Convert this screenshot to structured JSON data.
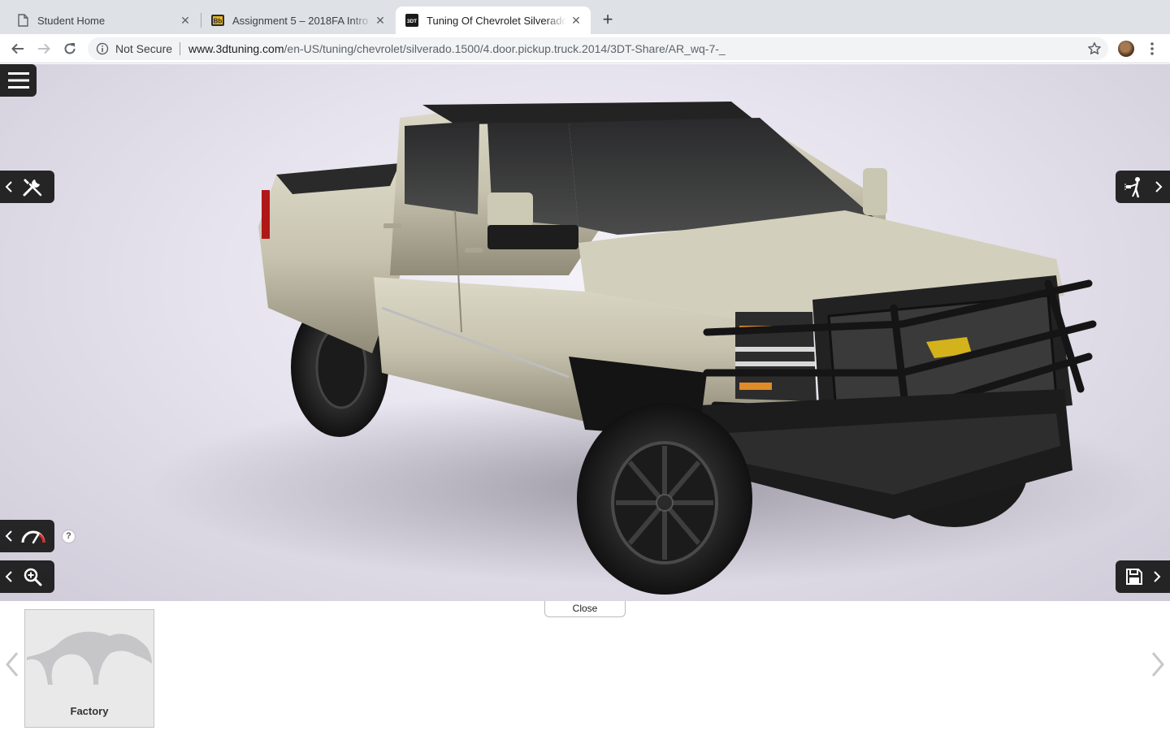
{
  "browser": {
    "tabs": [
      {
        "title": "Student Home",
        "active": false,
        "favicon": "page-icon"
      },
      {
        "title": "Assignment 5 – 2018FA Intro to",
        "active": false,
        "favicon": "blackboard-icon"
      },
      {
        "title": "Tuning Of Chevrolet Silverado",
        "active": true,
        "favicon": "3dtuning-icon"
      }
    ],
    "address": {
      "security_label": "Not Secure",
      "host": "www.3dtuning.com",
      "path": "/en-US/tuning/chevrolet/silverado.1500/4.door.pickup.truck.2014/3DT-Share/AR_wq-7-_"
    }
  },
  "viewer": {
    "help_label": "?",
    "colors": {
      "button_bg": "#161616",
      "body_paint": "#c9c6b2",
      "background": "#e6e3ee"
    },
    "buttons": [
      {
        "name": "main-menu-button",
        "icon": "hamburger-icon"
      },
      {
        "name": "tuning-tools-button",
        "icon": "wrench-screwdriver-icon"
      },
      {
        "name": "performance-button",
        "icon": "speedometer-icon"
      },
      {
        "name": "zoom-button",
        "icon": "zoom-in-icon"
      },
      {
        "name": "paint-booth-button",
        "icon": "spray-painter-icon"
      },
      {
        "name": "save-button",
        "icon": "floppy-disk-icon"
      }
    ]
  },
  "panel": {
    "close_label": "Close",
    "items": [
      {
        "label": "Factory",
        "selected": true
      }
    ]
  }
}
